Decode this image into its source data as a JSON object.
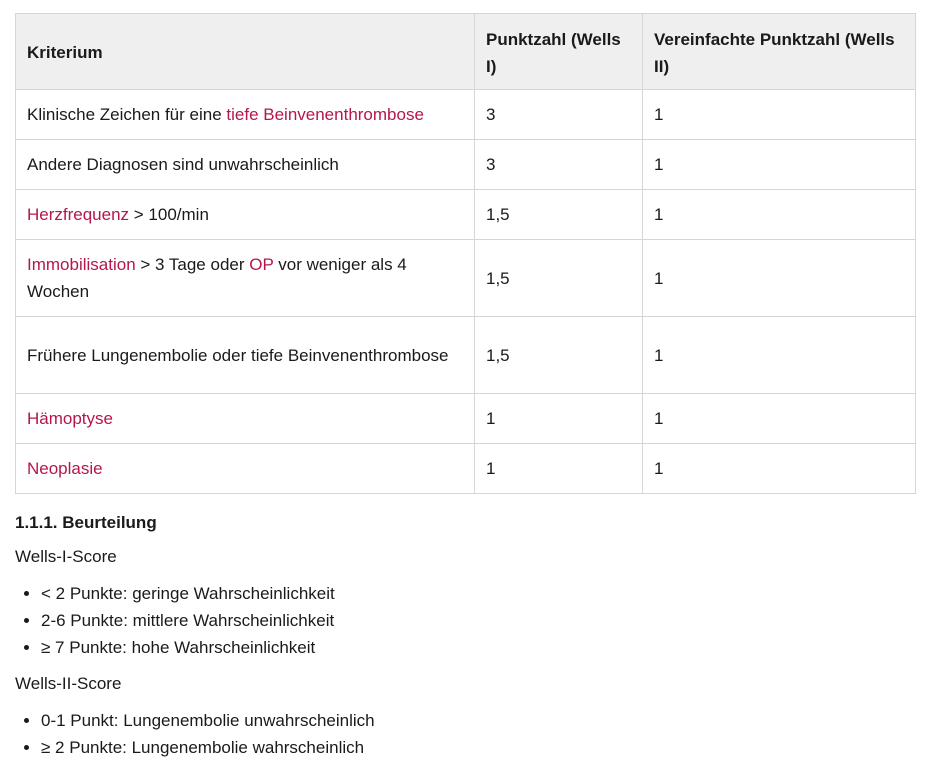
{
  "table": {
    "headers": [
      "Kriterium",
      "Punktzahl (Wells I)",
      "Vereinfachte Punktzahl (Wells II)"
    ],
    "rows": [
      {
        "pre": "Klinische Zeichen für eine ",
        "link": "tiefe Beinvenenthrombose",
        "post": "",
        "wells1": "3",
        "wells2": "1"
      },
      {
        "text": "Andere Diagnosen sind unwahrscheinlich",
        "wells1": "3",
        "wells2": "1"
      },
      {
        "link": "Herzfrequenz",
        "post": " > 100/min",
        "wells1": "1,5",
        "wells2": "1"
      },
      {
        "link": "Immobilisation",
        "mid": " > 3 Tage oder ",
        "link2": "OP",
        "post": " vor weniger als 4 Wochen",
        "wells1": "1,5",
        "wells2": "1"
      },
      {
        "text": "Frühere Lungenembolie oder tiefe Beinvenenthrombose",
        "wells1": "1,5",
        "wells2": "1"
      },
      {
        "link": "Hämoptyse",
        "wells1": "1",
        "wells2": "1"
      },
      {
        "link": "Neoplasie",
        "wells1": "1",
        "wells2": "1"
      }
    ]
  },
  "section": {
    "heading": "1.1.1. Beurteilung",
    "wells1_label": "Wells-I-Score",
    "wells1_items": [
      "< 2 Punkte: geringe Wahrscheinlichkeit",
      "2-6 Punkte: mittlere Wahrscheinlichkeit",
      "≥ 7 Punkte: hohe Wahrscheinlichkeit"
    ],
    "wells2_label": "Wells-II-Score",
    "wells2_items": [
      "0-1 Punkt: Lungenembolie unwahrscheinlich",
      "≥ 2 Punkte: Lungenembolie wahrscheinlich"
    ]
  },
  "colors": {
    "link": "#b5174b",
    "header_bg": "#efefef",
    "border": "#d6d6d6"
  }
}
